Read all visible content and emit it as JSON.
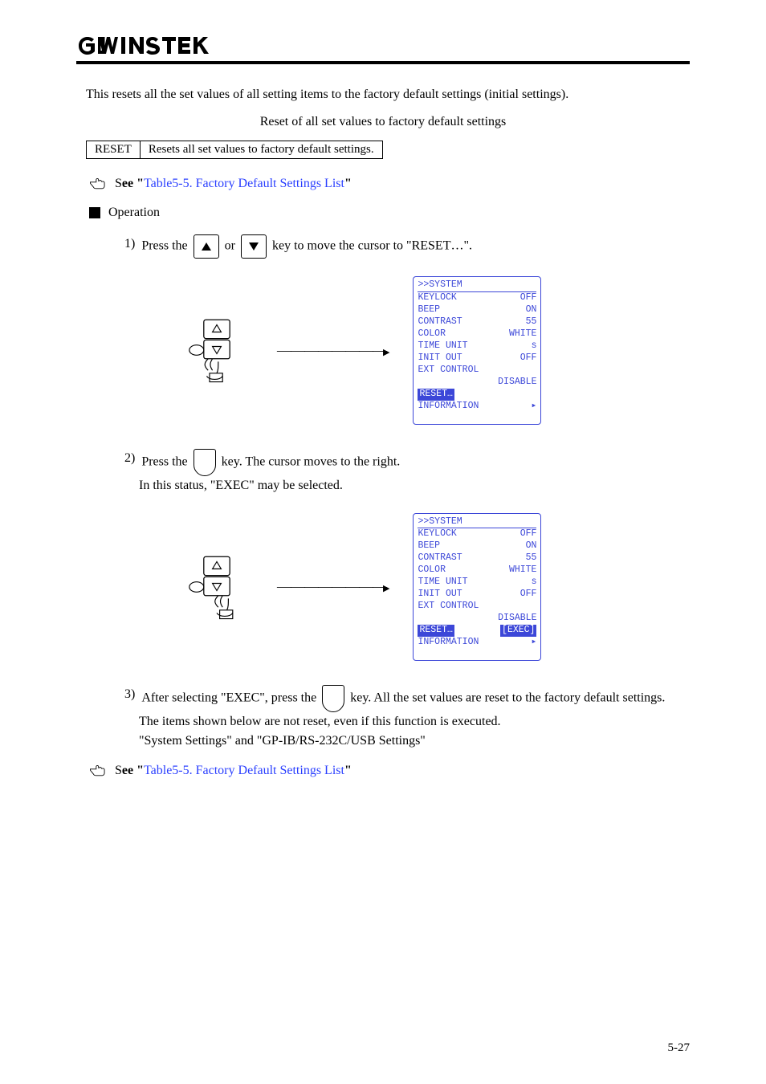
{
  "header": {
    "logo_text": "GW INSTEK"
  },
  "intro": "This resets all the set values of all setting items to the factory default settings (initial settings).",
  "table_heading": "Reset of all set values to factory default settings",
  "table_rows": [
    {
      "c1": "RESET",
      "c2": "Resets all set values to factory default settings."
    }
  ],
  "see1": {
    "prefix": "S",
    "bold": "ee \"",
    "link": "Table5-5. Factory Default Settings List",
    "after": "\""
  },
  "section": "Operation",
  "steps": {
    "s1": {
      "num": "1)",
      "t1": "Press the ",
      "t2": " or ",
      "t3": " key to move the cursor to \"RESET…\"."
    },
    "s2": {
      "num": "2)",
      "t1": "Press the ",
      "t2": " key. The cursor moves to the right.",
      "extra": "In this status, \"EXEC\" may be selected."
    },
    "s3": {
      "num": "3)",
      "t1": "After selecting \"EXEC\", press the ",
      "t2": " key. All the set values are reset to the factory default settings.",
      "line2": "The items shown below are not reset, even if this function is executed.",
      "line3": "\"System Settings\" and \"GP-IB/RS-232C/USB Settings\""
    }
  },
  "lcd1": {
    "title": ">>SYSTEM",
    "rows": [
      [
        "KEYLOCK",
        "OFF"
      ],
      [
        "BEEP",
        "ON"
      ],
      [
        "CONTRAST",
        "55"
      ],
      [
        "COLOR",
        "WHITE"
      ],
      [
        "TIME UNIT",
        "s"
      ],
      [
        "INIT OUT",
        "OFF"
      ],
      [
        "EXT CONTROL",
        ""
      ],
      [
        "",
        "DISABLE"
      ]
    ],
    "hl": "RESET…",
    "info": "INFORMATION"
  },
  "lcd2": {
    "title": ">>SYSTEM",
    "rows": [
      [
        "KEYLOCK",
        "OFF"
      ],
      [
        "BEEP",
        "ON"
      ],
      [
        "CONTRAST",
        "55"
      ],
      [
        "COLOR",
        "WHITE"
      ],
      [
        "TIME UNIT",
        "s"
      ],
      [
        "INIT OUT",
        "OFF"
      ],
      [
        "EXT CONTROL",
        ""
      ],
      [
        "",
        "DISABLE"
      ]
    ],
    "hl_left": "RESET…",
    "hl_right": "[EXEC]",
    "info": "INFORMATION"
  },
  "see2": {
    "prefix": "S",
    "bold": "ee \"",
    "link": "Table5-5. Factory Default Settings List",
    "after": "\""
  },
  "footer": "5-27"
}
